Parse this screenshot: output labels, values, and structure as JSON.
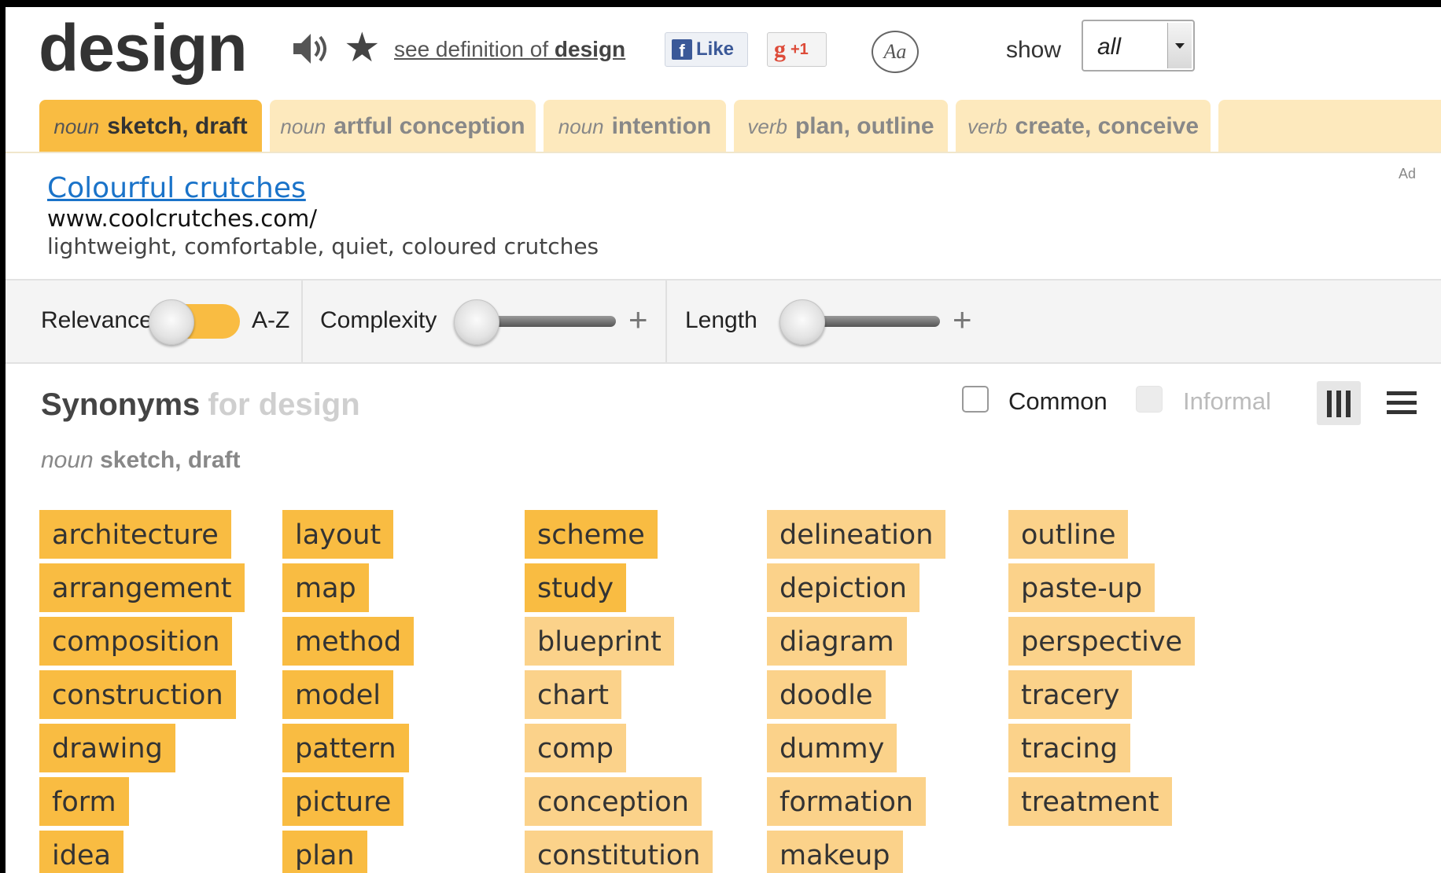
{
  "header": {
    "word": "design",
    "see_definition_prefix": "see definition of ",
    "see_definition_word": "design",
    "fb_like": "Like",
    "gplus": "+1",
    "font_button": "Aa",
    "show_label": "show",
    "show_value": "all"
  },
  "tabs": [
    {
      "pos": "noun",
      "label": "sketch, draft",
      "active": true
    },
    {
      "pos": "noun",
      "label": "artful conception",
      "active": false
    },
    {
      "pos": "noun",
      "label": "intention",
      "active": false
    },
    {
      "pos": "verb",
      "label": "plan, outline",
      "active": false
    },
    {
      "pos": "verb",
      "label": "create, conceive",
      "active": false
    }
  ],
  "ad": {
    "title": "Colourful crutches",
    "url": "www.coolcrutches.com/",
    "description": "lightweight, comfortable, quiet, coloured crutches",
    "tag": "Ad"
  },
  "filters": {
    "sort_left": "Relevance",
    "sort_right": "A-Z",
    "complexity": "Complexity",
    "length": "Length",
    "plus": "+"
  },
  "synonyms": {
    "heading": "Synonyms",
    "heading_for": "for design",
    "common_label": "Common",
    "informal_label": "Informal",
    "sense_pos": "noun",
    "sense_label": "sketch, draft",
    "columns": [
      [
        {
          "word": "architecture",
          "relevance": 3
        },
        {
          "word": "arrangement",
          "relevance": 3
        },
        {
          "word": "composition",
          "relevance": 3
        },
        {
          "word": "construction",
          "relevance": 3
        },
        {
          "word": "drawing",
          "relevance": 3
        },
        {
          "word": "form",
          "relevance": 3
        },
        {
          "word": "idea",
          "relevance": 3
        }
      ],
      [
        {
          "word": "layout",
          "relevance": 3
        },
        {
          "word": "map",
          "relevance": 3
        },
        {
          "word": "method",
          "relevance": 3
        },
        {
          "word": "model",
          "relevance": 3
        },
        {
          "word": "pattern",
          "relevance": 3
        },
        {
          "word": "picture",
          "relevance": 3
        },
        {
          "word": "plan",
          "relevance": 3
        }
      ],
      [
        {
          "word": "scheme",
          "relevance": 3
        },
        {
          "word": "study",
          "relevance": 3
        },
        {
          "word": "blueprint",
          "relevance": 2
        },
        {
          "word": "chart",
          "relevance": 2
        },
        {
          "word": "comp",
          "relevance": 2
        },
        {
          "word": "conception",
          "relevance": 2
        },
        {
          "word": "constitution",
          "relevance": 2
        }
      ],
      [
        {
          "word": "delineation",
          "relevance": 2
        },
        {
          "word": "depiction",
          "relevance": 2
        },
        {
          "word": "diagram",
          "relevance": 2
        },
        {
          "word": "doodle",
          "relevance": 2
        },
        {
          "word": "dummy",
          "relevance": 2
        },
        {
          "word": "formation",
          "relevance": 2
        },
        {
          "word": "makeup",
          "relevance": 2
        }
      ],
      [
        {
          "word": "outline",
          "relevance": 2
        },
        {
          "word": "paste-up",
          "relevance": 2
        },
        {
          "word": "perspective",
          "relevance": 2
        },
        {
          "word": "tracery",
          "relevance": 2
        },
        {
          "word": "tracing",
          "relevance": 2
        },
        {
          "word": "treatment",
          "relevance": 2
        }
      ]
    ]
  }
}
